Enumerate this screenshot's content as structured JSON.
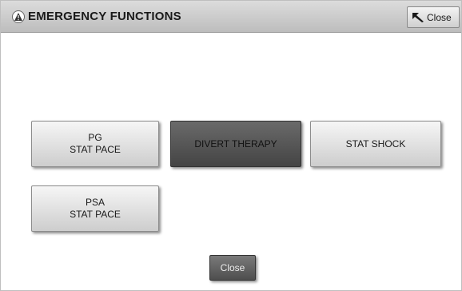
{
  "dialog": {
    "title": "EMERGENCY FUNCTIONS",
    "title_icon": "emergency-alert-icon",
    "close_top_label": "Close",
    "close_top_icon": "arrow-back-icon"
  },
  "buttons": {
    "pg_stat_pace": {
      "line1": "PG",
      "line2": "STAT PACE"
    },
    "divert_therapy": {
      "label": "DIVERT THERAPY"
    },
    "stat_shock": {
      "label": "STAT SHOCK"
    },
    "psa_stat_pace": {
      "line1": "PSA",
      "line2": "STAT PACE"
    }
  },
  "footer": {
    "close_label": "Close"
  },
  "colors": {
    "titlebar": "#c8c8c8",
    "button_face": "#e0e0e0",
    "button_active": "#555555"
  }
}
